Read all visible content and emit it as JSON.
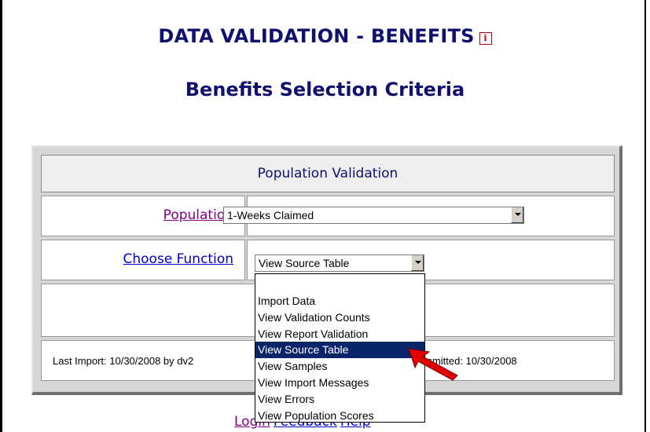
{
  "header": {
    "title": "DATA VALIDATION - BENEFITS",
    "info_icon": "i",
    "subtitle": "Benefits Selection Criteria"
  },
  "panel": {
    "heading": "Population Validation",
    "population": {
      "label": "Population",
      "selected": "1-Weeks Claimed"
    },
    "function": {
      "label": "Choose Function",
      "selected": "View Source Table",
      "options": [
        "Import Data",
        "View Validation Counts",
        "View Report Validation",
        "View Source Table",
        "View Samples",
        "View Import Messages",
        "View Errors",
        "View Population Scores"
      ],
      "highlighted_index": 3
    },
    "footer": {
      "last_import": "Last Import: 10/30/2008 by dv2",
      "transmitted": "ansmitted: 10/30/2008"
    }
  },
  "links": {
    "login": "Login",
    "feedback": "Feedback",
    "help": "Help"
  },
  "colors": {
    "title": "#10106e",
    "visited_link": "#800080",
    "link": "#0000cc",
    "highlight": "#0a246a",
    "pointer_arrow": "#e00000"
  },
  "icons": {
    "info": "info-icon",
    "pointer": "red-arrow-icon"
  }
}
